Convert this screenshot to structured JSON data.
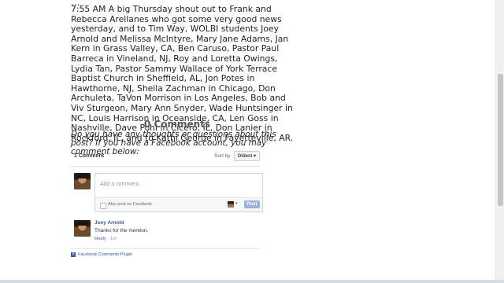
{
  "post": {
    "ellipsis": "...",
    "body": "7:55 AM A big Thursday shout out to Frank and Rebecca Arellanes who got some very good news yesterday, and to Tim Way, WOLBI students Joey Arnold and Melissa McIntyre, Mary Jane Adams, Jan Kern in Grass Valley, CA, Ben Caruso, Pastor Paul Barreca in Vineland, NJ, Roy and Loretta Owings, Lydia Tan, Pastor Sammy Wallace of York Terrace Baptist Church in Sheffield, AL, Jon Potes in Hawthorne, NJ, Sheila Zachman in Chicago, Don Archuleta, TaVon Morrison in Los Angeles, Bob and Viv Sturgeon, Mary Ann Snyder, Wade Huntsinger in NC, Louis Harrison in Oceanside, CA, Len Goss in Nashville, Dave Pohl in Cicero, IL, Don Lanier in Rockford, IL, and to Kathi George in Fayetteville, AR."
  },
  "comments_section": {
    "heading": "0 Comments",
    "prompt": "Do you have any thoughts or questions about this post? If you have a Facebook account, you may comment below:"
  },
  "fb_plugin": {
    "comment_count": "1 Comment",
    "sort_label": "Sort by",
    "sort_value": "Oldest",
    "sort_caret": "▾",
    "compose_placeholder": "Add a comment...",
    "also_post_label": "Also post on Facebook",
    "mini_caret": "▾",
    "post_button": "Post",
    "comments": [
      {
        "author": "Joey Arnold",
        "body": "Thanks for the mention.",
        "reply": "Reply",
        "separator": " · ",
        "time": "1m"
      }
    ],
    "footer_logo": "f",
    "footer_label": "Facebook Comments Plugin"
  },
  "colors": {
    "link_blue": "#3b5998",
    "post_button_bg": "#9cb4d8"
  },
  "icons": {
    "sort_caret": "chevron-down-icon",
    "facebook": "facebook-icon"
  }
}
